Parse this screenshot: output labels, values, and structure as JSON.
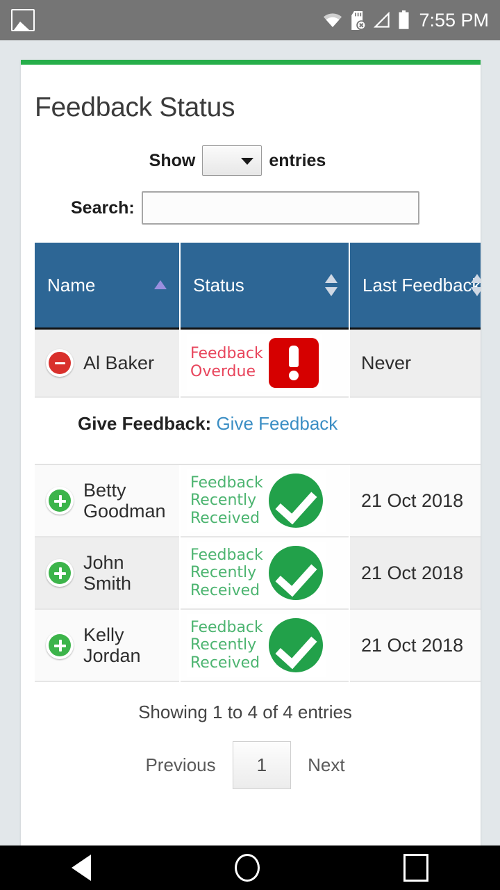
{
  "statusbar": {
    "time": "7:55 PM",
    "icons": [
      "photo-icon",
      "wifi-icon",
      "sd-card-error-icon",
      "signal-icon",
      "battery-icon"
    ]
  },
  "page": {
    "title": "Feedback Status",
    "accent_top": "#27ae4a"
  },
  "controls": {
    "show_label": "Show",
    "entries_label": "entries",
    "length_value": "",
    "search_label": "Search:",
    "search_value": "",
    "search_placeholder": ""
  },
  "table": {
    "columns": [
      {
        "label": "Name",
        "sort": "asc"
      },
      {
        "label": "Status",
        "sort": "none"
      },
      {
        "label": "Last Feedback",
        "sort": "none"
      }
    ],
    "rows": [
      {
        "toggle": "minus",
        "name": "Al Baker",
        "status_text": "Feedback Overdue",
        "status_line1": "Feedback",
        "status_line2": "Overdue",
        "status_line3": "",
        "status_kind": "overdue",
        "status_icon": "exclamation-icon",
        "last_feedback": "Never",
        "expanded": true,
        "child": {
          "label": "Give Feedback:",
          "link": "Give Feedback"
        }
      },
      {
        "toggle": "plus",
        "name": "Betty Goodman",
        "status_text": "Feedback Recently Received",
        "status_line1": "Feedback",
        "status_line2": "Recently",
        "status_line3": "Received",
        "status_kind": "received",
        "status_icon": "check-circle-icon",
        "last_feedback": "21 Oct 2018",
        "expanded": false
      },
      {
        "toggle": "plus",
        "name": "John Smith",
        "status_text": "Feedback Recently Received",
        "status_line1": "Feedback",
        "status_line2": "Recently",
        "status_line3": "Received",
        "status_kind": "received",
        "status_icon": "check-circle-icon",
        "last_feedback": "21 Oct 2018",
        "expanded": false
      },
      {
        "toggle": "plus",
        "name": "Kelly Jordan",
        "status_text": "Feedback Recently Received",
        "status_line1": "Feedback",
        "status_line2": "Recently",
        "status_line3": "Received",
        "status_kind": "received",
        "status_icon": "check-circle-icon",
        "last_feedback": "21 Oct 2018",
        "expanded": false
      }
    ]
  },
  "footer": {
    "info": "Showing 1 to 4 of 4 entries",
    "previous": "Previous",
    "current_page": "1",
    "next": "Next"
  },
  "navbar": {
    "back": "back-icon",
    "home": "home-icon",
    "recents": "recents-icon"
  },
  "colors": {
    "header_blue": "#2d6695",
    "accent_green": "#27ae4a",
    "overdue_red": "#d60000",
    "received_green": "#22a14a",
    "link_blue": "#3b8ec4"
  }
}
